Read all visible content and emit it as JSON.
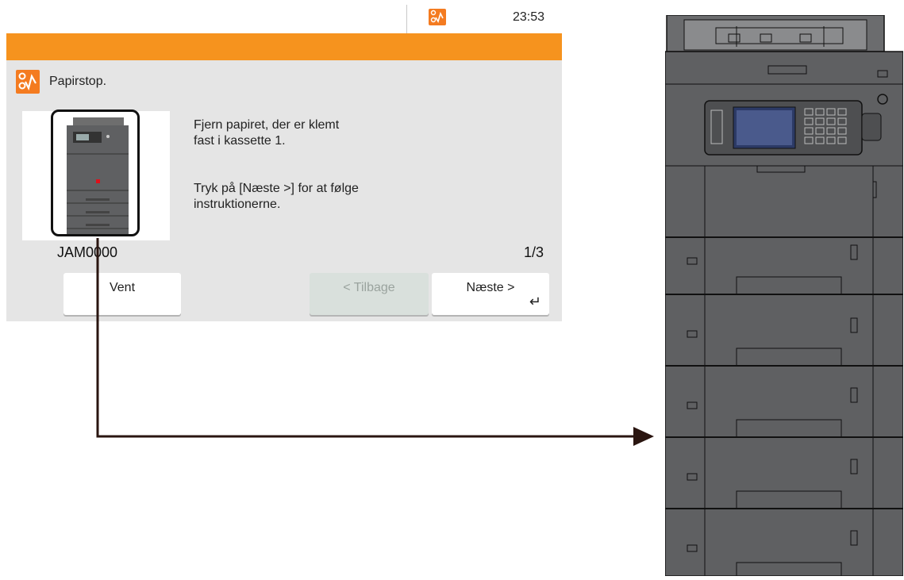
{
  "status_bar": {
    "time": "23:53"
  },
  "message": {
    "title": "Papirstop.",
    "line1": "Fjern papiret, der er klemt",
    "line2": "fast i kassette 1.",
    "line3": "Tryk på [Næste >] for at følge",
    "line4": "instruktionerne.",
    "code": "JAM0000",
    "page": "1/3"
  },
  "buttons": {
    "wait": "Vent",
    "back": "< Tilbage",
    "next": "Næste >"
  },
  "colors": {
    "accent": "#f6931e",
    "panel_bg": "#e5e5e5",
    "printer_body": "#5f6062"
  },
  "icons": {
    "status": "paper-jam-icon",
    "enter": "enter-icon"
  }
}
